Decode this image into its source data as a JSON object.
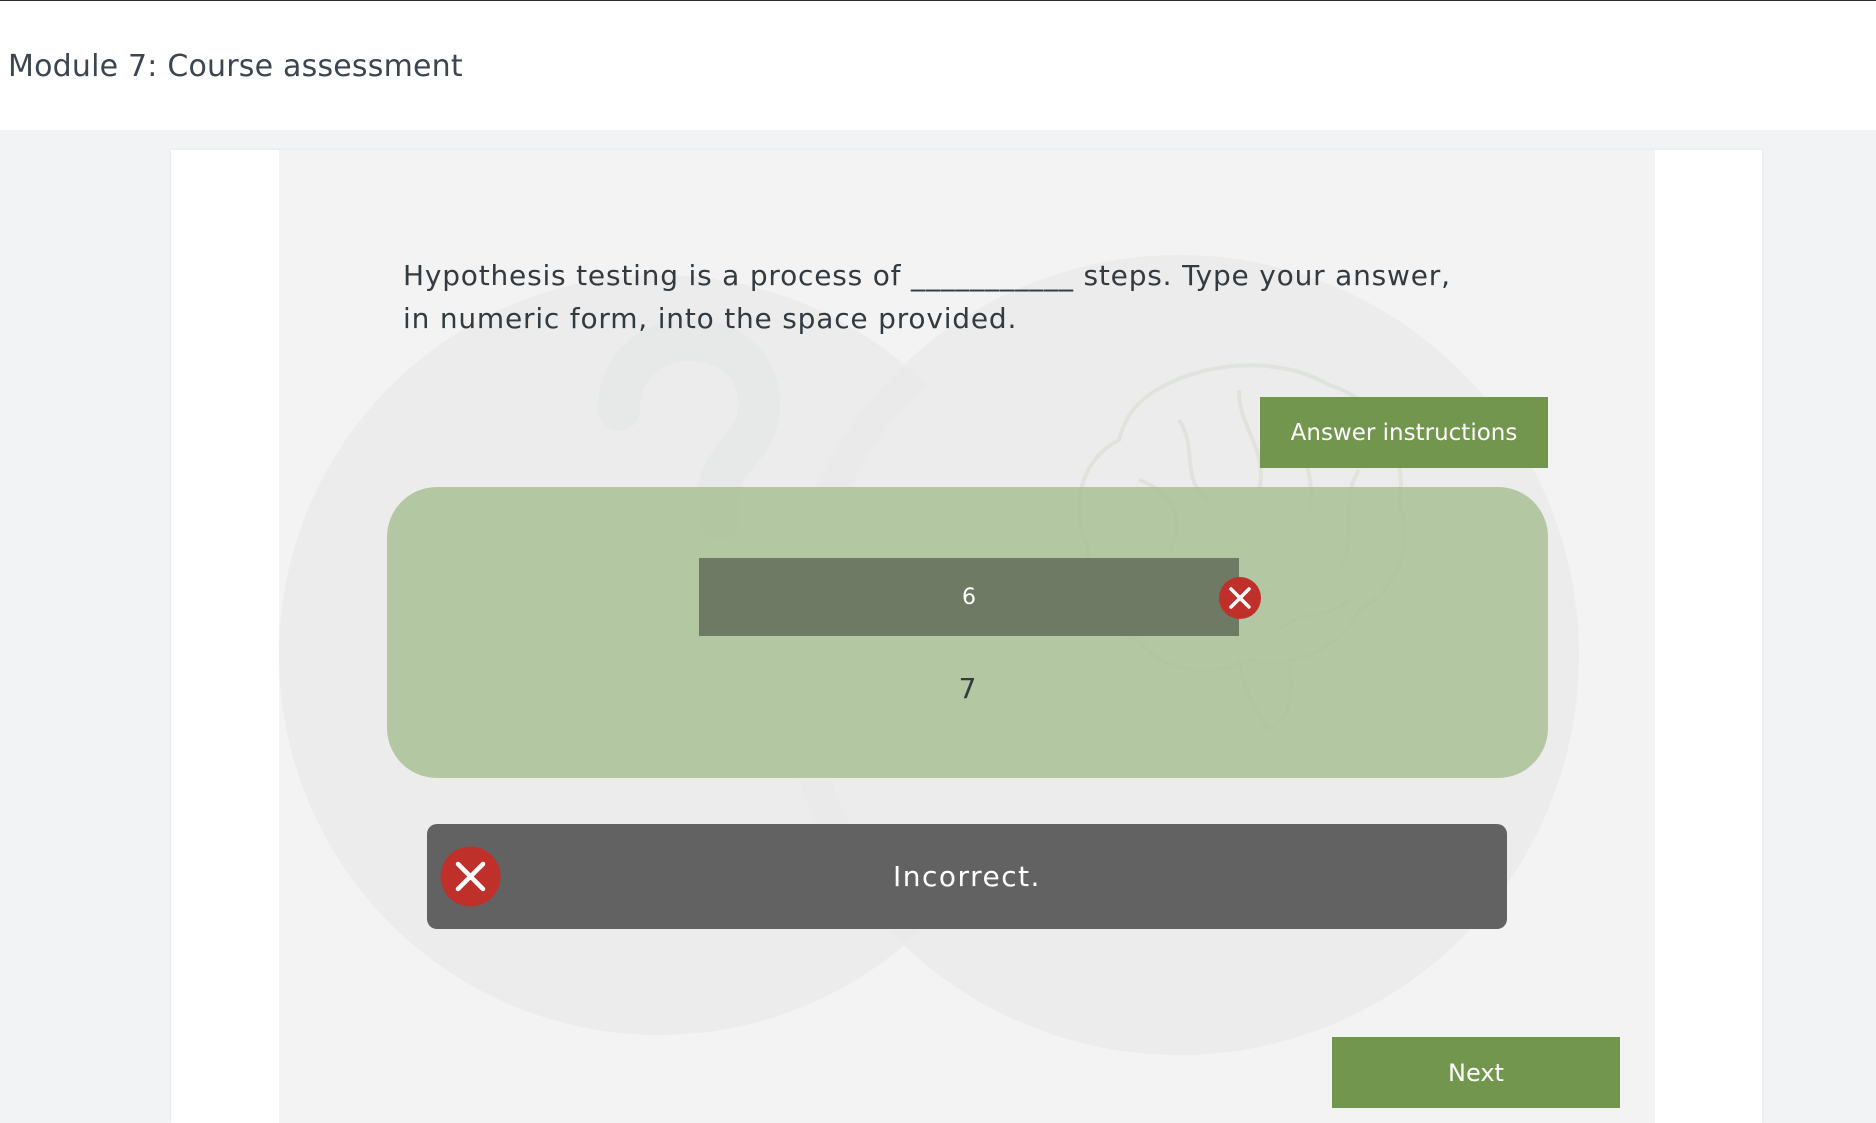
{
  "header": {
    "title": "Module 7: Course assessment"
  },
  "question": {
    "text": "Hypothesis testing is a process of ___________ steps. Type your answer, in numeric form, into the space provided."
  },
  "buttons": {
    "answer_instructions": "Answer instructions",
    "next": "Next"
  },
  "answer": {
    "user_value": "6",
    "correct_value": "7"
  },
  "feedback": {
    "message": "Incorrect."
  },
  "colors": {
    "accent_green": "#73964f",
    "panel_green": "#a3bc8e",
    "incorrect_red": "#c0302a",
    "feedback_bg": "#626262"
  },
  "icons": {
    "answer_status": "close-circle-icon",
    "feedback_status": "close-circle-icon",
    "background": [
      "question-mark-icon",
      "brain-icon"
    ]
  }
}
